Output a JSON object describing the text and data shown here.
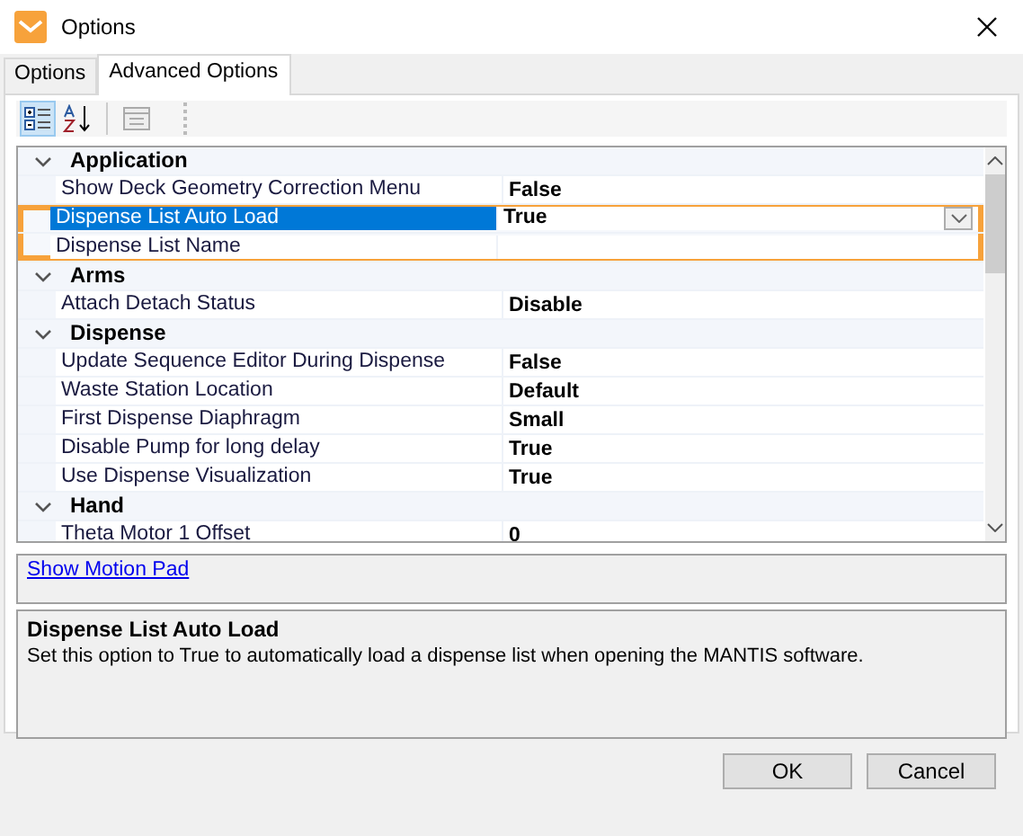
{
  "window": {
    "title": "Options"
  },
  "tabs": [
    {
      "label": "Options",
      "selected": false
    },
    {
      "label": "Advanced Options",
      "selected": true
    }
  ],
  "toolbar": [
    {
      "kind": "categorized",
      "selected": true
    },
    {
      "kind": "alphabetical",
      "selected": false
    },
    {
      "kind": "property-pages",
      "disabled": true
    }
  ],
  "grid": {
    "categories": [
      {
        "name": "Application",
        "expanded": true,
        "properties": [
          {
            "name": "Show Deck Geometry Correction Menu",
            "value": "False",
            "selected": false,
            "highlighted": false
          },
          {
            "name": "Dispense List Auto Load",
            "value": "True",
            "selected": true,
            "highlighted": true
          },
          {
            "name": "Dispense List Name",
            "selected": false,
            "highlighted": true
          }
        ]
      },
      {
        "name": "Arms",
        "expanded": true,
        "properties": [
          {
            "name": "Attach Detach Status",
            "value": "Disable",
            "selected": false,
            "highlighted": false
          }
        ]
      },
      {
        "name": "Dispense",
        "expanded": true,
        "properties": [
          {
            "name": "Update Sequence Editor During Dispense",
            "value": "False",
            "selected": false,
            "highlighted": false
          },
          {
            "name": "Waste Station Location",
            "value": "Default",
            "selected": false,
            "highlighted": false
          },
          {
            "name": "First Dispense Diaphragm",
            "value": "Small",
            "selected": false,
            "highlighted": false
          },
          {
            "name": "Disable Pump for long delay",
            "value": "True",
            "selected": false,
            "highlighted": false
          },
          {
            "name": "Use Dispense Visualization",
            "value": "True",
            "selected": false,
            "highlighted": false
          }
        ]
      },
      {
        "name": "Hand",
        "expanded": true,
        "properties": [
          {
            "name": "Theta Motor 1 Offset",
            "value": "0",
            "selected": false,
            "highlighted": false
          }
        ]
      }
    ]
  },
  "link": "Show Motion Pad",
  "description": {
    "title": "Dispense List Auto Load",
    "text": "Set this option to True to automatically load a dispense list when opening the MANTIS software."
  },
  "buttons": [
    "OK",
    "Cancel"
  ]
}
